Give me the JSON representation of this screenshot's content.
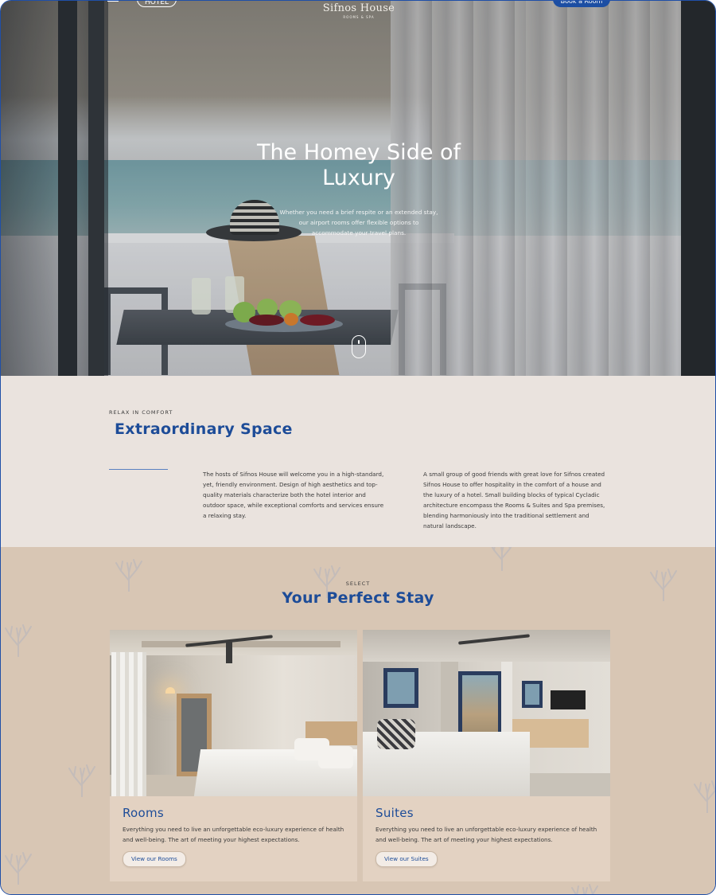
{
  "header": {
    "menu_pill": "HOTEL",
    "logo_name": "Sifnos House",
    "logo_sub": "ROOMS & SPA",
    "book_label": "Book a Room"
  },
  "hero": {
    "title": "The Homey Side of Luxury",
    "subtitle": "Whether you need a brief respite or an extended stay, our airport rooms offer flexible options to accommodate your travel plans."
  },
  "intro": {
    "kicker": "RELAX IN COMFORT",
    "title": "Extraordinary Space",
    "paragraph_1": "The hosts of Sifnos House will welcome you in a high-standard, yet, friendly environment. Design of high aesthetics and top-quality materials characterize both the hotel interior and outdoor space, while exceptional comforts and services ensure a relaxing stay.",
    "paragraph_2": "A small group of good friends with great love for Sifnos created Sifnos House to offer hospitality in the comfort of a house and the luxury of a hotel. Small building blocks of typical Cycladic architecture encompass the Rooms & Suites and Spa premises, blending harmoniously into the traditional settlement and natural landscape."
  },
  "stays": {
    "kicker": "SELECT",
    "title": "Your Perfect Stay",
    "cards": [
      {
        "title": "Rooms",
        "description": "Everything you need to live an unforgettable eco-luxury experience of health and well-being. The art of meeting your highest expectations.",
        "button": "View our Rooms"
      },
      {
        "title": "Suites",
        "description": "Everything you need to live an unforgettable eco-luxury experience of health and well-being. The art of meeting your highest expectations.",
        "button": "View our Suites"
      }
    ]
  },
  "colors": {
    "accent_blue": "#1d4c98",
    "intro_bg": "#eae3de",
    "stays_bg": "#d8c6b4",
    "card_bg": "#e3d2c2"
  },
  "icons": [
    "menu-icon",
    "scroll-down-icon",
    "coral-icon"
  ]
}
